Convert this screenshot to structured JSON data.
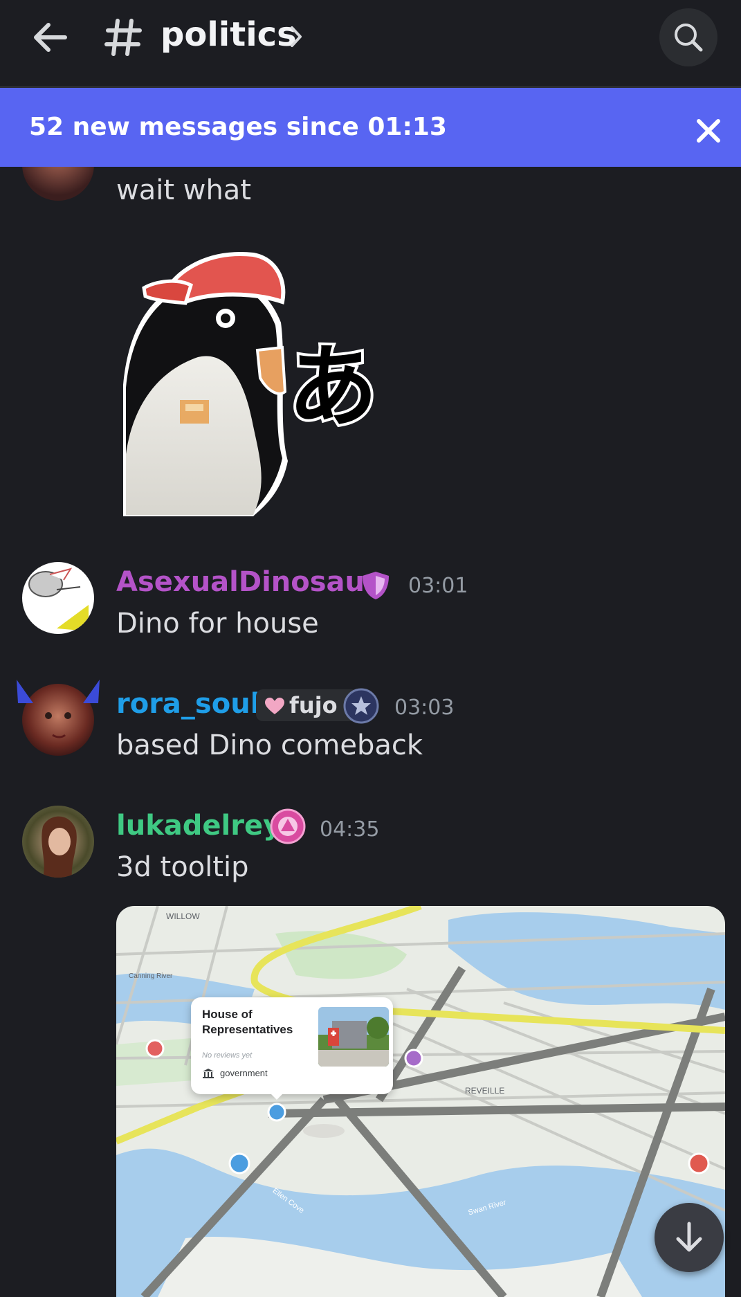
{
  "header": {
    "channel_name": "politics",
    "icons": [
      "arrow-left-icon",
      "hash-icon",
      "chevron-right-icon",
      "search-icon"
    ]
  },
  "new_messages_bar": {
    "text": "52 new messages since 01:13",
    "close_icon": "close-icon",
    "color": "#5865f2"
  },
  "messages": [
    {
      "text": "wait what"
    },
    {
      "author": "AsexualDinosaur",
      "author_color": "#b453c8",
      "badge_icon": "shield-icon",
      "time": "03:01",
      "text": "Dino for house"
    },
    {
      "author": "rora_soul",
      "author_color": "#1f9ee8",
      "role_tag": "fujo",
      "badge_icon": "star-badge-icon",
      "time": "03:03",
      "text": "based Dino comeback"
    },
    {
      "author": "lukadelrey",
      "author_color": "#3fc983",
      "badge_icon": "nitro-badge-icon",
      "time": "04:35",
      "text": "3d tooltip"
    }
  ],
  "sticker": {
    "glyph": "あ"
  },
  "map_embed": {
    "tooltip": {
      "title": "House of Representatives",
      "reviews": "No reviews yet",
      "category": "government"
    },
    "labels": [
      "WILLOW",
      "REVEILLE",
      "Canning River",
      "Swan River",
      "Ellen Cove"
    ]
  },
  "scroll_button": {
    "icon": "arrow-down-icon"
  }
}
